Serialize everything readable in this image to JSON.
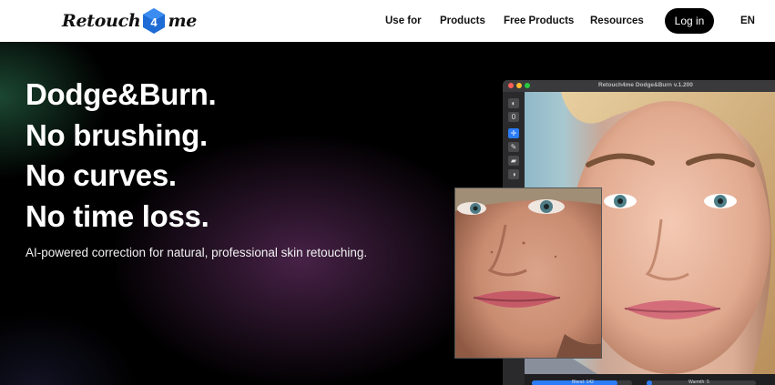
{
  "header": {
    "logo": {
      "text_left": "Retouch",
      "mark": "4",
      "text_right": "me"
    },
    "nav": [
      "Use for",
      "Products",
      "Free Products",
      "Resources"
    ],
    "login": "Log in",
    "language": "EN"
  },
  "hero": {
    "headline": [
      "Dodge&Burn.",
      "No brushing.",
      "No curves.",
      "No time loss."
    ],
    "subtext": "AI-powered correction for natural, professional skin retouching."
  },
  "app_window": {
    "title": "Retouch4me Dodge&Burn v.1.200",
    "tools": [
      {
        "icon": "eye-icon",
        "glyph": "◐"
      },
      {
        "icon": "zero-icon",
        "glyph": "0"
      },
      {
        "icon": "move-icon",
        "glyph": "✛"
      },
      {
        "icon": "brush-icon",
        "glyph": "✎"
      },
      {
        "icon": "eraser-icon",
        "glyph": "▰"
      },
      {
        "icon": "contrast-icon",
        "glyph": "◑"
      }
    ],
    "sliders": [
      {
        "label": "Blend: 142",
        "value": 0.85
      },
      {
        "label": "Warmth: 5",
        "value": 0.05
      }
    ]
  },
  "colors": {
    "accent": "#2b7cf6",
    "logo_blue": "#1e6bd6",
    "background": "#000000"
  }
}
